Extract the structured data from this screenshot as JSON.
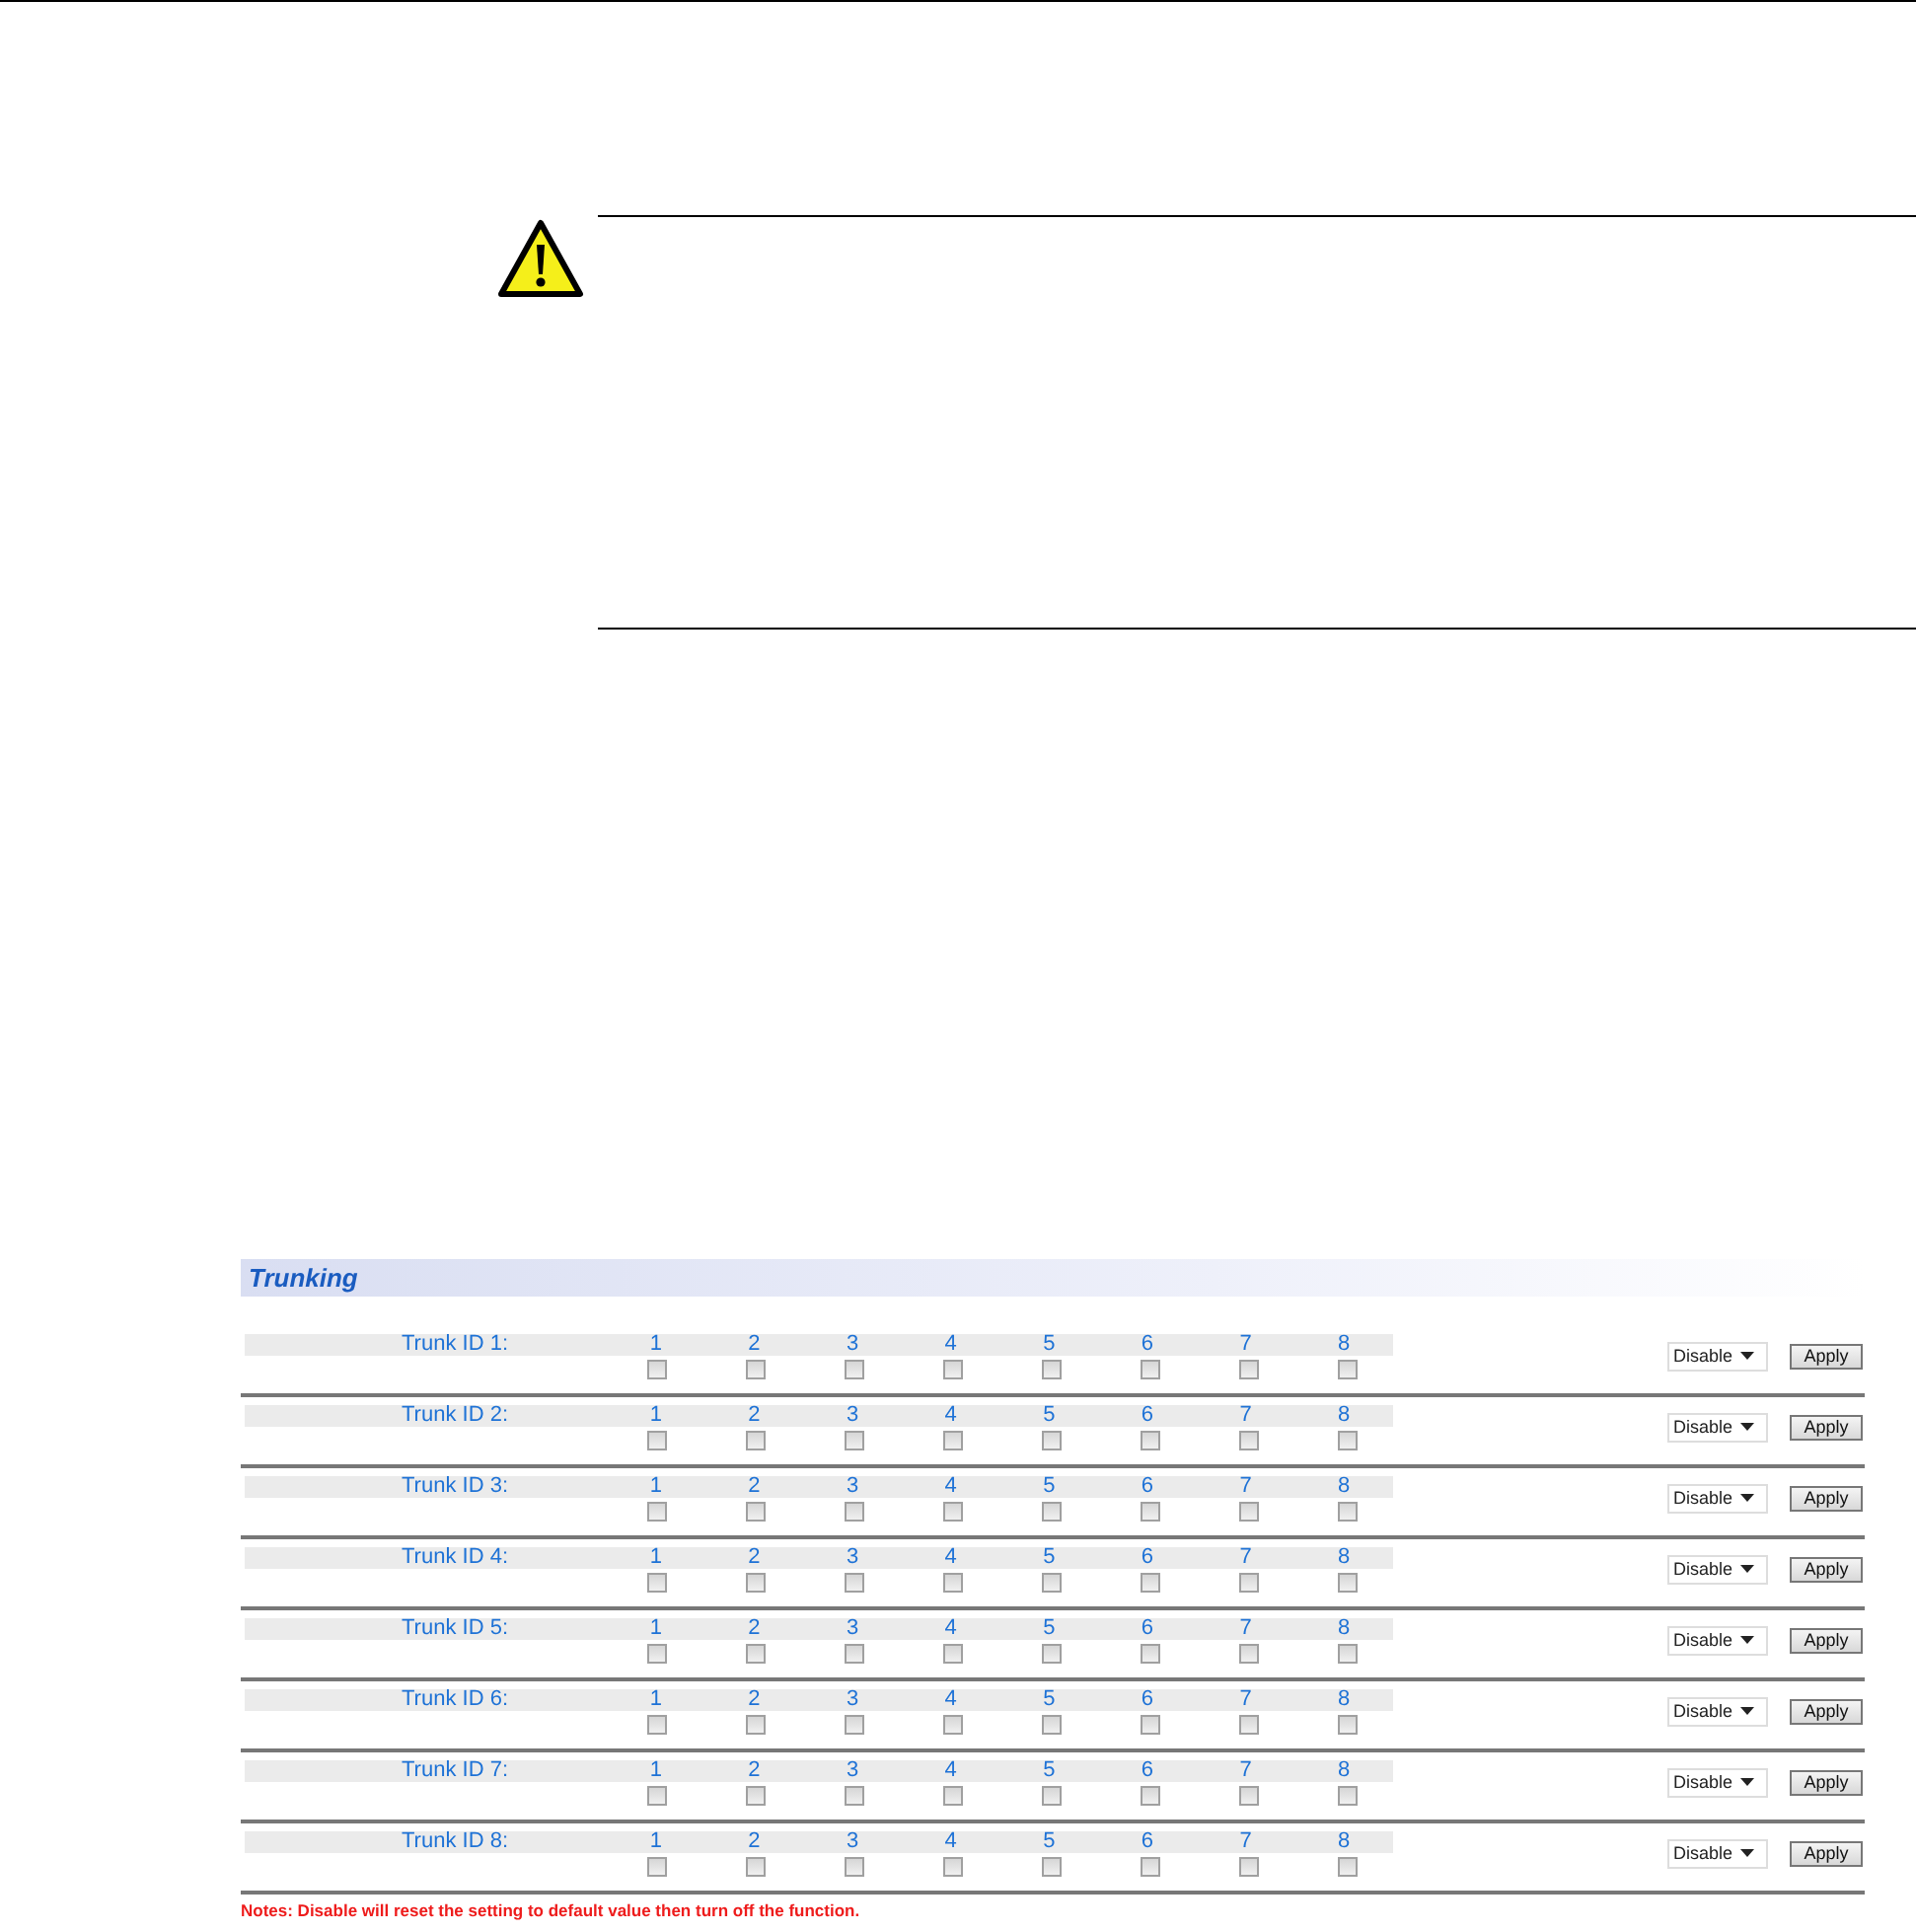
{
  "panel": {
    "title": "Trunking",
    "trunks": [
      {
        "label": "Trunk ID 1:",
        "ports": [
          {
            "number": "1",
            "checked": false
          },
          {
            "number": "2",
            "checked": false
          },
          {
            "number": "3",
            "checked": false
          },
          {
            "number": "4",
            "checked": false
          },
          {
            "number": "5",
            "checked": false
          },
          {
            "number": "6",
            "checked": false
          },
          {
            "number": "7",
            "checked": false
          },
          {
            "number": "8",
            "checked": false
          }
        ],
        "mode": "Disable",
        "button": "Apply"
      },
      {
        "label": "Trunk ID 2:",
        "ports": [
          {
            "number": "1",
            "checked": false
          },
          {
            "number": "2",
            "checked": false
          },
          {
            "number": "3",
            "checked": false
          },
          {
            "number": "4",
            "checked": false
          },
          {
            "number": "5",
            "checked": false
          },
          {
            "number": "6",
            "checked": false
          },
          {
            "number": "7",
            "checked": false
          },
          {
            "number": "8",
            "checked": false
          }
        ],
        "mode": "Disable",
        "button": "Apply"
      },
      {
        "label": "Trunk ID 3:",
        "ports": [
          {
            "number": "1",
            "checked": false
          },
          {
            "number": "2",
            "checked": false
          },
          {
            "number": "3",
            "checked": false
          },
          {
            "number": "4",
            "checked": false
          },
          {
            "number": "5",
            "checked": false
          },
          {
            "number": "6",
            "checked": false
          },
          {
            "number": "7",
            "checked": false
          },
          {
            "number": "8",
            "checked": false
          }
        ],
        "mode": "Disable",
        "button": "Apply"
      },
      {
        "label": "Trunk ID 4:",
        "ports": [
          {
            "number": "1",
            "checked": false
          },
          {
            "number": "2",
            "checked": false
          },
          {
            "number": "3",
            "checked": false
          },
          {
            "number": "4",
            "checked": false
          },
          {
            "number": "5",
            "checked": false
          },
          {
            "number": "6",
            "checked": false
          },
          {
            "number": "7",
            "checked": false
          },
          {
            "number": "8",
            "checked": false
          }
        ],
        "mode": "Disable",
        "button": "Apply"
      },
      {
        "label": "Trunk ID 5:",
        "ports": [
          {
            "number": "1",
            "checked": false
          },
          {
            "number": "2",
            "checked": false
          },
          {
            "number": "3",
            "checked": false
          },
          {
            "number": "4",
            "checked": false
          },
          {
            "number": "5",
            "checked": false
          },
          {
            "number": "6",
            "checked": false
          },
          {
            "number": "7",
            "checked": false
          },
          {
            "number": "8",
            "checked": false
          }
        ],
        "mode": "Disable",
        "button": "Apply"
      },
      {
        "label": "Trunk ID 6:",
        "ports": [
          {
            "number": "1",
            "checked": false
          },
          {
            "number": "2",
            "checked": false
          },
          {
            "number": "3",
            "checked": false
          },
          {
            "number": "4",
            "checked": false
          },
          {
            "number": "5",
            "checked": false
          },
          {
            "number": "6",
            "checked": false
          },
          {
            "number": "7",
            "checked": false
          },
          {
            "number": "8",
            "checked": false
          }
        ],
        "mode": "Disable",
        "button": "Apply"
      },
      {
        "label": "Trunk ID 7:",
        "ports": [
          {
            "number": "1",
            "checked": false
          },
          {
            "number": "2",
            "checked": false
          },
          {
            "number": "3",
            "checked": false
          },
          {
            "number": "4",
            "checked": false
          },
          {
            "number": "5",
            "checked": false
          },
          {
            "number": "6",
            "checked": false
          },
          {
            "number": "7",
            "checked": false
          },
          {
            "number": "8",
            "checked": false
          }
        ],
        "mode": "Disable",
        "button": "Apply"
      },
      {
        "label": "Trunk ID 8:",
        "ports": [
          {
            "number": "1",
            "checked": false
          },
          {
            "number": "2",
            "checked": false
          },
          {
            "number": "3",
            "checked": false
          },
          {
            "number": "4",
            "checked": false
          },
          {
            "number": "5",
            "checked": false
          },
          {
            "number": "6",
            "checked": false
          },
          {
            "number": "7",
            "checked": false
          },
          {
            "number": "8",
            "checked": false
          }
        ],
        "mode": "Disable",
        "button": "Apply"
      }
    ],
    "note": "Notes: Disable will reset the setting to default value then turn off the function."
  }
}
